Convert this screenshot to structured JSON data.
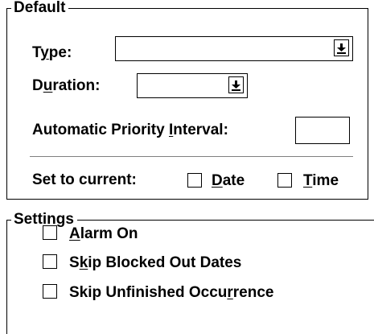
{
  "default_group": {
    "title": "Default",
    "type_label_pre": "T",
    "type_label_mn": "y",
    "type_label_post": "pe:",
    "type_value": "",
    "duration_label_pre": "D",
    "duration_label_mn": "u",
    "duration_label_post": "ration:",
    "duration_value": "",
    "priority_label_pre": "Automatic Priority ",
    "priority_label_mn": "I",
    "priority_label_post": "nterval:",
    "priority_value": "",
    "set_current_label": "Set to current:",
    "date_label_mn": "D",
    "date_label_post": "ate",
    "time_label_mn": "T",
    "time_label_post": "ime",
    "date_checked": false,
    "time_checked": false
  },
  "settings_group": {
    "title": "Settings",
    "alarm_mn": "A",
    "alarm_post": "larm On",
    "alarm_checked": false,
    "skip_blocked_pre": "S",
    "skip_blocked_mn": "k",
    "skip_blocked_post": "ip Blocked Out Dates",
    "skip_blocked_checked": false,
    "skip_unfinished_pre": "Skip Unfinished Occu",
    "skip_unfinished_mn": "r",
    "skip_unfinished_post": "rence",
    "skip_unfinished_checked": false
  },
  "icons": {
    "dropdown_arrow": "down-arrow-to-bar-icon"
  }
}
